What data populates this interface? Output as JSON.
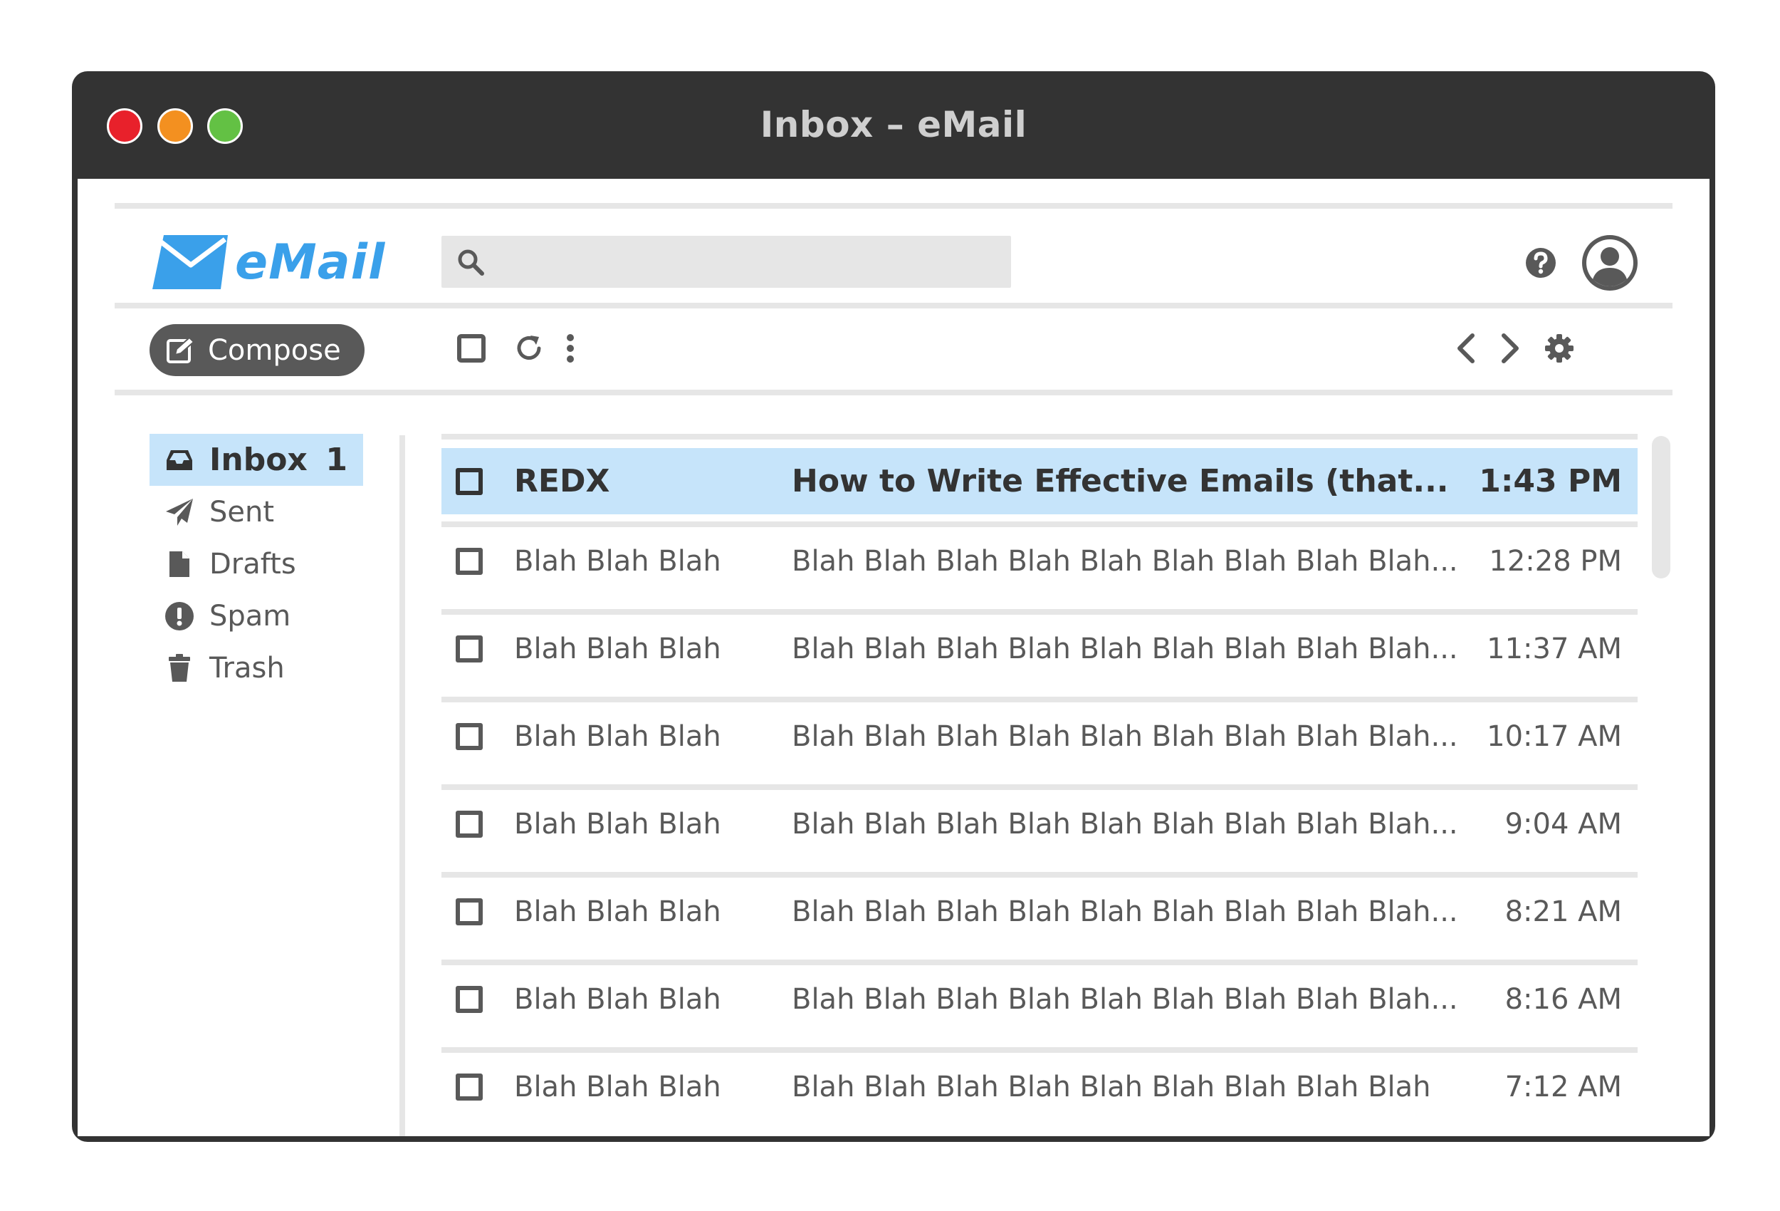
{
  "window": {
    "title": "Inbox – eMail"
  },
  "app": {
    "logo_text": "eMail"
  },
  "search": {
    "value": "",
    "placeholder": ""
  },
  "toolbar": {
    "compose_label": "Compose"
  },
  "sidebar": {
    "items": [
      {
        "label": "Inbox",
        "count": "1",
        "icon": "inbox-icon",
        "active": true
      },
      {
        "label": "Sent",
        "icon": "paper-plane-icon"
      },
      {
        "label": "Drafts",
        "icon": "file-icon"
      },
      {
        "label": "Spam",
        "icon": "exclamation-circle-icon"
      },
      {
        "label": "Trash",
        "icon": "trash-icon"
      }
    ]
  },
  "emails": [
    {
      "sender": "REDX",
      "subject": "How to Write Effective Emails (that...",
      "time": "1:43 PM",
      "unread": true
    },
    {
      "sender": "Blah Blah Blah",
      "subject": "Blah Blah Blah Blah Blah Blah Blah Blah Blah...",
      "time": "12:28 PM"
    },
    {
      "sender": "Blah Blah Blah",
      "subject": "Blah Blah Blah Blah Blah Blah Blah Blah Blah...",
      "time": "11:37 AM"
    },
    {
      "sender": "Blah Blah Blah",
      "subject": "Blah Blah Blah Blah Blah Blah Blah Blah Blah...",
      "time": "10:17 AM"
    },
    {
      "sender": "Blah Blah Blah",
      "subject": "Blah Blah Blah Blah Blah Blah Blah Blah Blah...",
      "time": "9:04 AM"
    },
    {
      "sender": "Blah Blah Blah",
      "subject": "Blah Blah Blah Blah Blah Blah Blah Blah Blah...",
      "time": "8:21 AM"
    },
    {
      "sender": "Blah Blah Blah",
      "subject": "Blah Blah Blah Blah Blah Blah Blah Blah Blah...",
      "time": "8:16 AM"
    },
    {
      "sender": "Blah Blah Blah",
      "subject": "Blah Blah Blah Blah Blah Blah Blah Blah Blah",
      "time": "7:12 AM"
    }
  ],
  "colors": {
    "accent": "#3aa0ea",
    "selected": "#c6e4fa",
    "chrome": "#333333",
    "text": "#595959",
    "divider": "#e6e6e6"
  }
}
